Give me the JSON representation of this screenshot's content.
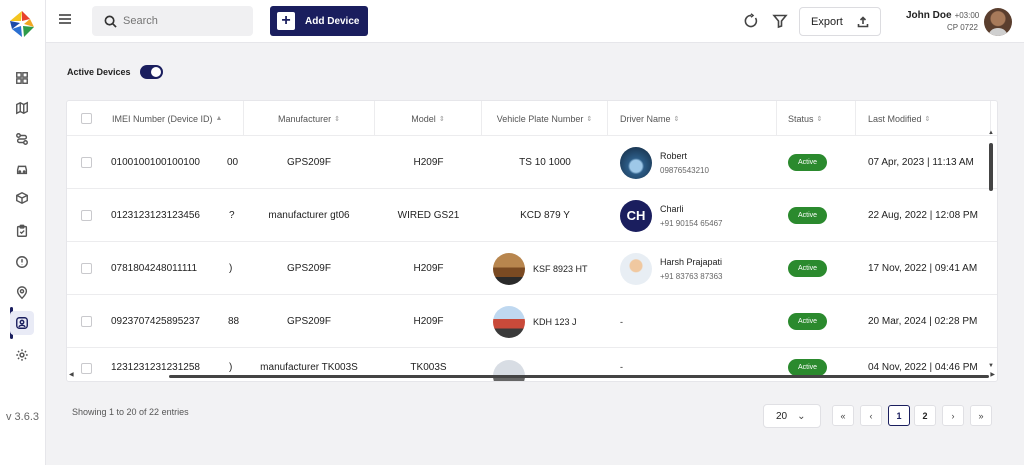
{
  "app": {
    "version": "v 3.6.3"
  },
  "header": {
    "search_placeholder": "Search",
    "add_device_label": "Add Device",
    "export_label": "Export",
    "user": {
      "name": "John Doe",
      "timezone": "+03:00",
      "subtitle": "CP 0722"
    }
  },
  "sidebar": {
    "items": [
      {
        "icon": "dashboard-icon"
      },
      {
        "icon": "map-icon"
      },
      {
        "icon": "route-icon"
      },
      {
        "icon": "car-icon"
      },
      {
        "icon": "box-icon"
      },
      {
        "icon": "clipboard-icon"
      },
      {
        "icon": "alert-icon"
      },
      {
        "icon": "location-pin-icon"
      },
      {
        "icon": "device-user-icon",
        "active": true
      },
      {
        "icon": "gear-icon"
      }
    ]
  },
  "filters": {
    "active_devices_label": "Active Devices",
    "active_devices_on": true
  },
  "table": {
    "columns": {
      "imei": "IMEI Number (Device ID)",
      "manufacturer": "Manufacturer",
      "model": "Model",
      "plate": "Vehicle Plate Number",
      "driver": "Driver Name",
      "status": "Status",
      "modified": "Last Modified"
    },
    "rows": [
      {
        "imei": "0100100100100100",
        "cut": "00",
        "manufacturer": "GPS209F",
        "model": "H209F",
        "plate": "TS 10 1000",
        "plate_img": false,
        "driver_name": "Robert",
        "driver_phone": "09876543210",
        "driver_avatar": "photo-blue",
        "status": "Active",
        "modified": "07 Apr, 2023 | 11:13 AM"
      },
      {
        "imei": "0123123123123456",
        "cut": "?",
        "manufacturer": "manufacturer gt06",
        "model": "WIRED GS21",
        "plate": "KCD 879 Y",
        "plate_img": false,
        "driver_name": "Charli",
        "driver_phone": "+91 90154 65467",
        "driver_avatar": "CH",
        "status": "Active",
        "modified": "22 Aug, 2022 | 12:08 PM"
      },
      {
        "imei": "0781804248011111",
        "cut": ")",
        "manufacturer": "GPS209F",
        "model": "H209F",
        "plate": "KSF 8923 HT",
        "plate_img": true,
        "driver_name": "Harsh Prajapati",
        "driver_phone": "+91 83763 87363",
        "driver_avatar": "photo-person",
        "status": "Active",
        "modified": "17 Nov, 2022 | 09:41 AM"
      },
      {
        "imei": "0923707425895237",
        "cut": "88",
        "manufacturer": "GPS209F",
        "model": "H209F",
        "plate": "KDH 123 J",
        "plate_img": true,
        "driver_name": "-",
        "driver_phone": "",
        "driver_avatar": "",
        "status": "Active",
        "modified": "20 Mar, 2024 | 02:28 PM"
      },
      {
        "imei": "1231231231231258",
        "cut": ")",
        "manufacturer": "manufacturer TK003S",
        "model": "TK003S",
        "plate": "",
        "plate_img": true,
        "driver_name": "-",
        "driver_phone": "",
        "driver_avatar": "",
        "status": "Active",
        "modified": "04 Nov, 2022 | 04:46 PM"
      }
    ]
  },
  "footer": {
    "showing": "Showing 1 to 20 of 22 entries",
    "page_size": "20",
    "pages": [
      "1",
      "2"
    ],
    "current_page": "1"
  },
  "colors": {
    "primary": "#1a1e5e",
    "active": "#2b8a2e"
  }
}
